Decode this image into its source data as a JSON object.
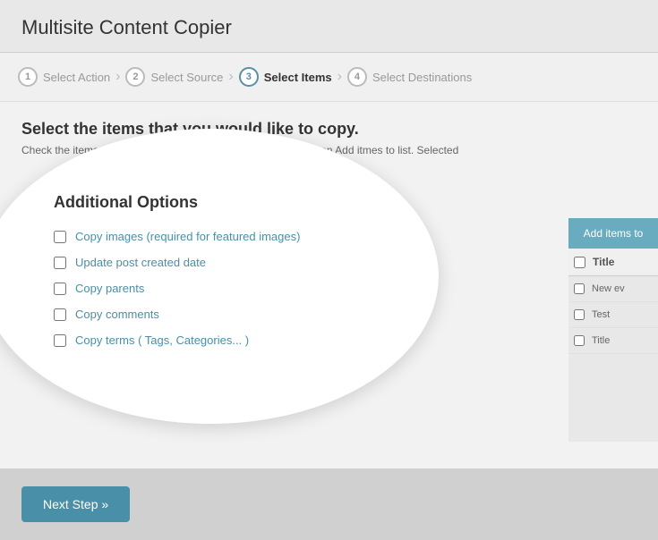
{
  "app": {
    "title": "Multisite Content Copier"
  },
  "steps": [
    {
      "num": "1",
      "label": "Select Action",
      "active": false
    },
    {
      "num": "2",
      "label": "Select Source",
      "active": false
    },
    {
      "num": "3",
      "label": "Select Items",
      "active": true
    },
    {
      "num": "4",
      "label": "Select Destinations",
      "active": false
    }
  ],
  "main": {
    "heading": "Select the items that you would like to copy.",
    "subtitle": "Check the items in the list that you would like to copy and click on Add itmes to list. Selected"
  },
  "overlay": {
    "title": "Additional Options",
    "options": [
      {
        "id": "opt1",
        "label": "Copy images (required for featured images)"
      },
      {
        "id": "opt2",
        "label": "Update post created date"
      },
      {
        "id": "opt3",
        "label": "Copy parents"
      },
      {
        "id": "opt4",
        "label": "Copy comments"
      },
      {
        "id": "opt5",
        "label": "Copy terms ( Tags, Categories... )"
      }
    ]
  },
  "buttons": {
    "next_step": "Next Step »",
    "add_items": "Add items to"
  },
  "items_panel": {
    "column_label": "Title",
    "rows": [
      {
        "label": "New ev"
      },
      {
        "label": "Test"
      },
      {
        "label": "Title"
      }
    ]
  }
}
